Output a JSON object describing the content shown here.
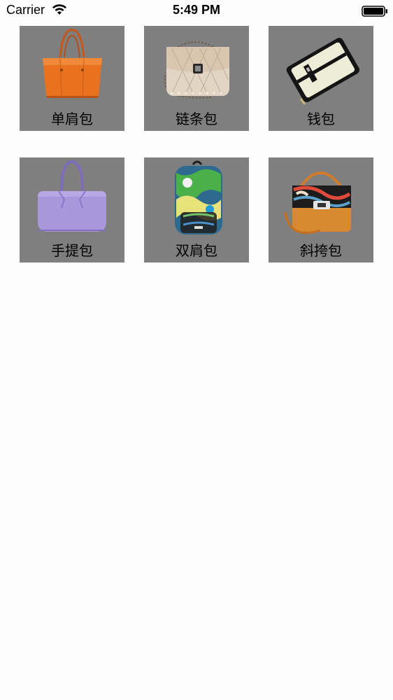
{
  "status_bar": {
    "carrier": "Carrier",
    "time": "5:49 PM",
    "icons": [
      "wifi-icon",
      "battery-icon"
    ]
  },
  "categories": [
    {
      "label": "单肩包",
      "image": "orange-shoulder-bag"
    },
    {
      "label": "链条包",
      "image": "chain-bag"
    },
    {
      "label": "钱包",
      "image": "wallet"
    },
    {
      "label": "手提包",
      "image": "purple-handbag"
    },
    {
      "label": "双肩包",
      "image": "backpack"
    },
    {
      "label": "斜挎包",
      "image": "crossbody-bag"
    }
  ],
  "colors": {
    "tile_background": "#7f7f7f",
    "page_background": "#fdfdfd"
  }
}
